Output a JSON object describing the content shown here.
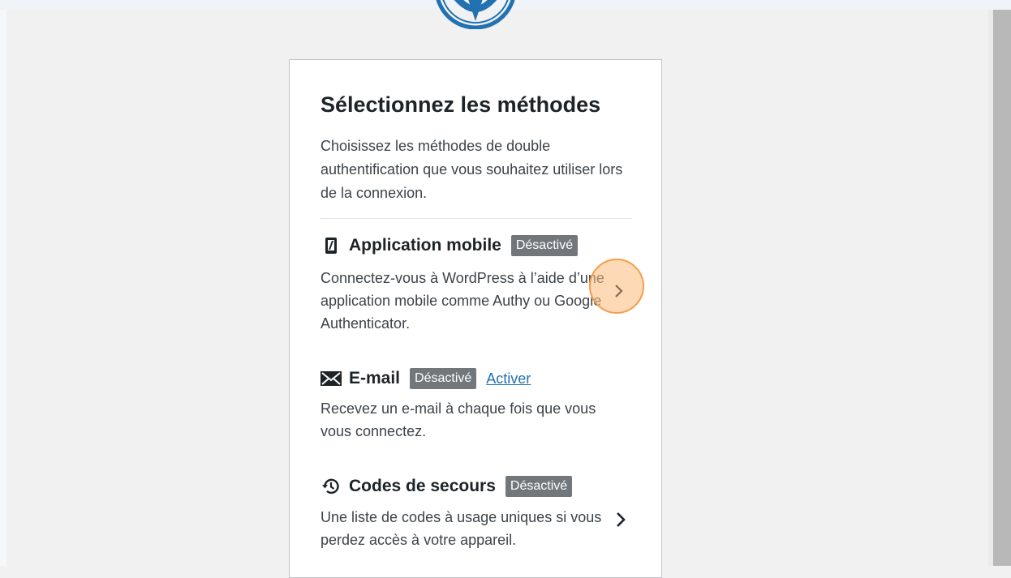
{
  "card": {
    "title": "Sélectionnez les méthodes",
    "intro": "Choisissez les méthodes de double authentification que vous souhaitez utiliser lors de la connexion."
  },
  "methods": [
    {
      "name": "Application mobile",
      "icon": "smartphone-icon",
      "status": "Désactivé",
      "description": "Connectez-vous à WordPress à l’aide d’une application mobile comme Authy ou Google Authenticator."
    },
    {
      "name": "E-mail",
      "icon": "envelope-icon",
      "status": "Désactivé",
      "action": "Activer",
      "description": "Recevez un e-mail à chaque fois que vous vous connectez."
    },
    {
      "name": "Codes de secours",
      "icon": "history-icon",
      "status": "Désactivé",
      "description": "Une liste de codes à usage uniques si vous perdez accès à votre appareil."
    }
  ],
  "colors": {
    "wp_blue": "#2271b1",
    "badge_gray": "#72777c",
    "marker_orange": "#f59d4a"
  }
}
